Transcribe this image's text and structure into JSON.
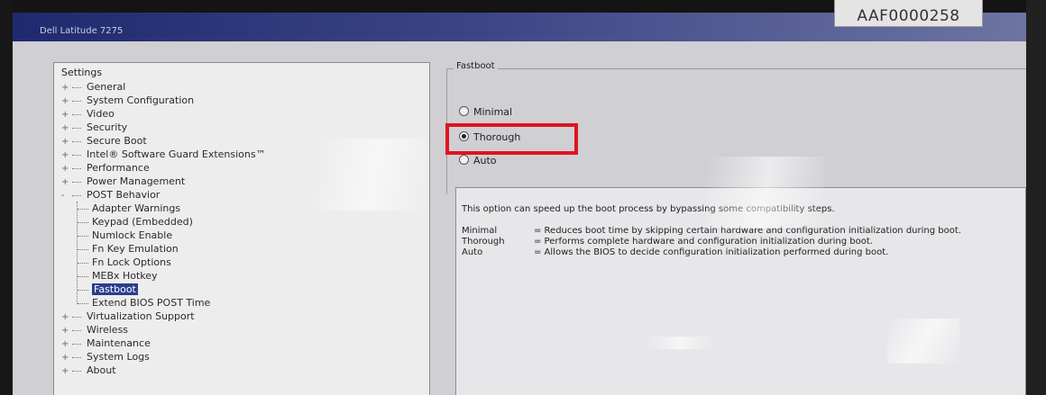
{
  "asset_tag": "AAF0000258",
  "window": {
    "title": "Dell Latitude 7275"
  },
  "tree": {
    "header": "Settings",
    "items": [
      {
        "label": "General",
        "level": 1,
        "toggle": "+"
      },
      {
        "label": "System Configuration",
        "level": 1,
        "toggle": "+"
      },
      {
        "label": "Video",
        "level": 1,
        "toggle": "+"
      },
      {
        "label": "Security",
        "level": 1,
        "toggle": "+"
      },
      {
        "label": "Secure Boot",
        "level": 1,
        "toggle": "+"
      },
      {
        "label": "Intel® Software Guard Extensions™",
        "level": 1,
        "toggle": "+"
      },
      {
        "label": "Performance",
        "level": 1,
        "toggle": "+"
      },
      {
        "label": "Power Management",
        "level": 1,
        "toggle": "+"
      },
      {
        "label": "POST Behavior",
        "level": 1,
        "toggle": "-"
      },
      {
        "label": "Adapter Warnings",
        "level": 2
      },
      {
        "label": "Keypad (Embedded)",
        "level": 2
      },
      {
        "label": "Numlock Enable",
        "level": 2
      },
      {
        "label": "Fn Key Emulation",
        "level": 2
      },
      {
        "label": "Fn Lock Options",
        "level": 2
      },
      {
        "label": "MEBx Hotkey",
        "level": 2
      },
      {
        "label": "Fastboot",
        "level": 2,
        "selected": true
      },
      {
        "label": "Extend BIOS POST Time",
        "level": 2
      },
      {
        "label": "Virtualization Support",
        "level": 1,
        "toggle": "+"
      },
      {
        "label": "Wireless",
        "level": 1,
        "toggle": "+"
      },
      {
        "label": "Maintenance",
        "level": 1,
        "toggle": "+"
      },
      {
        "label": "System Logs",
        "level": 1,
        "toggle": "+"
      },
      {
        "label": "About",
        "level": 1,
        "toggle": "+"
      }
    ]
  },
  "fastboot": {
    "legend": "Fastboot",
    "options": [
      {
        "label": "Minimal",
        "selected": false
      },
      {
        "label": "Thorough",
        "selected": true
      },
      {
        "label": "Auto",
        "selected": false
      }
    ],
    "highlight_color": "#e0141e"
  },
  "description": {
    "intro": "This option can speed up the boot process by bypassing some compatibility steps.",
    "rows": [
      {
        "term": "Minimal",
        "text": "= Reduces boot time by skipping certain hardware and configuration initialization during boot."
      },
      {
        "term": "Thorough",
        "text": "= Performs complete hardware and configuration initialization during boot."
      },
      {
        "term": "Auto",
        "text": "= Allows the BIOS to decide configuration initialization performed during boot."
      }
    ]
  },
  "colors": {
    "selection": "#2c3d8f",
    "titlebar": "#1f2a6e"
  }
}
